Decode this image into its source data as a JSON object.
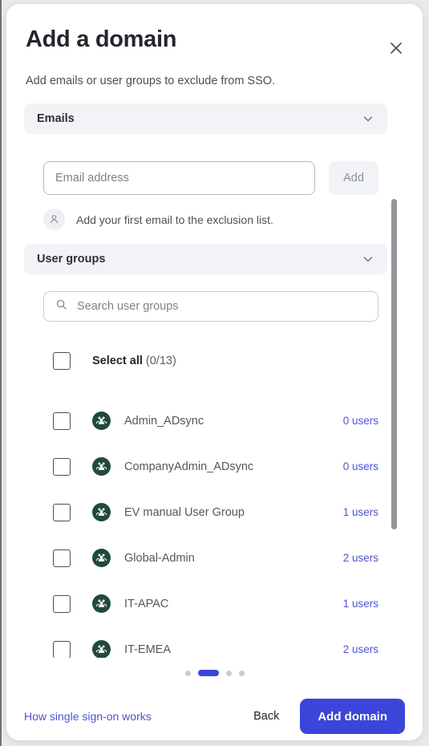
{
  "modal": {
    "title": "Add a domain",
    "subtitle": "Add emails or user groups to exclude from SSO.",
    "close_icon": "close-icon"
  },
  "emails_section": {
    "label": "Emails",
    "chevron_icon": "chevron-down-icon",
    "input": {
      "placeholder": "Email address",
      "value": ""
    },
    "add_button": "Add",
    "empty_state": {
      "icon": "person-icon",
      "text": "Add your first email to the exclusion list."
    }
  },
  "groups_section": {
    "label": "User groups",
    "chevron_icon": "chevron-down-icon",
    "search": {
      "icon": "search-icon",
      "placeholder": "Search user groups",
      "value": ""
    },
    "select_all": {
      "label": "Select all",
      "count": "(0/13)",
      "checked": false
    },
    "groups": [
      {
        "name": "Admin_ADsync",
        "users": "0 users",
        "checked": false,
        "avatar_icon": "user-group-icon"
      },
      {
        "name": "CompanyAdmin_ADsync",
        "users": "0 users",
        "checked": false,
        "avatar_icon": "user-group-icon"
      },
      {
        "name": "EV manual User Group",
        "users": "1 users",
        "checked": false,
        "avatar_icon": "user-group-icon"
      },
      {
        "name": "Global-Admin",
        "users": "2 users",
        "checked": false,
        "avatar_icon": "user-group-icon"
      },
      {
        "name": "IT-APAC",
        "users": "1 users",
        "checked": false,
        "avatar_icon": "user-group-icon"
      },
      {
        "name": "IT-EMEA",
        "users": "2 users",
        "checked": false,
        "avatar_icon": "user-group-icon"
      }
    ]
  },
  "pagination": {
    "total": 4,
    "active_index": 1
  },
  "footer": {
    "help_link": "How single sign-on works",
    "back_button": "Back",
    "primary_button": "Add domain"
  },
  "colors": {
    "accent": "#3b45d9",
    "link": "#4f54cf",
    "avatar_green": "#1f4a3e",
    "section_bar": "#f2f3f7"
  }
}
